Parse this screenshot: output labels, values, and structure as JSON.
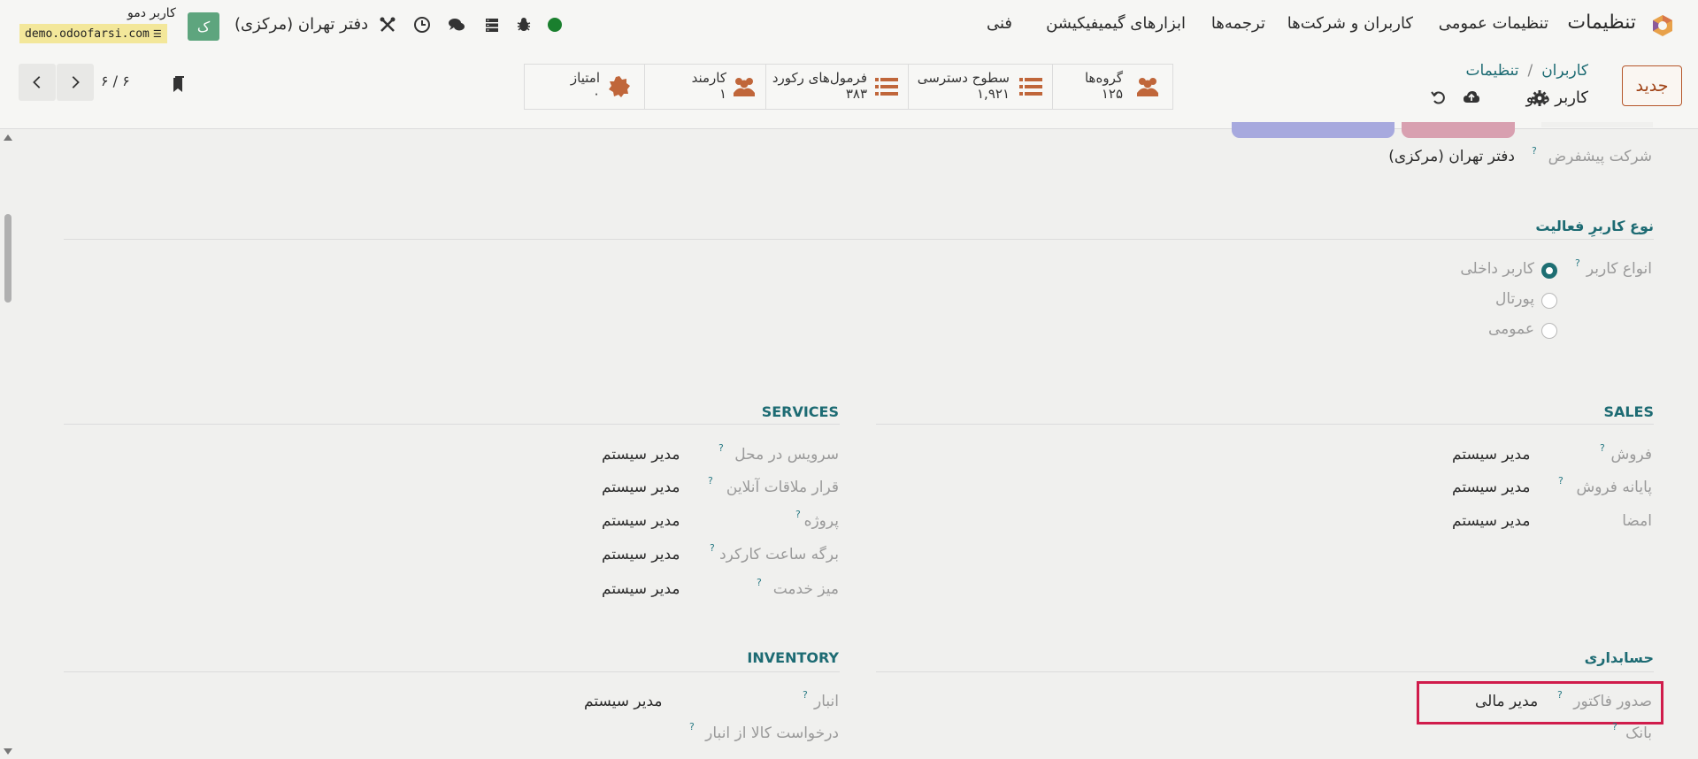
{
  "topbar": {
    "app_title": "تنظیمات",
    "menu": [
      "تنظیمات عمومی",
      "کاربران و شرکت‌ها",
      "ترجمه‌ها",
      "ابزارهای گیمیفیکیشن",
      "فنی"
    ],
    "company": "دفتر تهران (مرکزی)",
    "user_name": "کاربر دمو",
    "db_name": "demo.odoofarsi.com",
    "avatar_letter": "ک",
    "status_color": "#1a7f2e"
  },
  "control": {
    "new_button": "جدید",
    "breadcrumb_parent": "تنظیمات",
    "breadcrumb_sep": "/",
    "breadcrumb_current": "کاربران",
    "record_name": "کاربر دمو",
    "pager": "۶ / ۶",
    "stats": [
      {
        "label": "گروه‌ها",
        "value": "۱۲۵",
        "icon": "users-icon"
      },
      {
        "label": "سطوح دسترسی",
        "value": "۱,۹۲۱",
        "icon": "list-icon"
      },
      {
        "label": "فرمول‌های رکورد",
        "value": "۳۸۳",
        "icon": "list-icon"
      },
      {
        "label": "کارمند",
        "value": "۱",
        "icon": "users-icon"
      },
      {
        "label": "امتیاز",
        "value": "۰",
        "icon": "badge-icon"
      }
    ]
  },
  "form": {
    "default_company_label": "شرکت پیشفرض",
    "default_company_value": "دفتر تهران (مرکزی)",
    "user_type_section": "نوع کاربرِ فعالیت",
    "user_type_label": "انواع کاربر",
    "user_types": [
      "کاربر داخلی",
      "پورتال",
      "عمومی"
    ],
    "sales_title": "SALES",
    "services_title": "SERVICES",
    "accounting_title": "حسابداری",
    "inventory_title": "INVENTORY",
    "sales": [
      {
        "label": "فروش",
        "value": "مدیر سیستم"
      },
      {
        "label": "پایانه فروش",
        "value": "مدیر سیستم"
      },
      {
        "label": "امضا",
        "value": "مدیر سیستم"
      }
    ],
    "services": [
      {
        "label": "سرویس در محل",
        "value": "مدیر سیستم"
      },
      {
        "label": "قرار ملاقات آنلاین",
        "value": "مدیر سیستم"
      },
      {
        "label": "پروژه",
        "value": "مدیر سیستم"
      },
      {
        "label": "برگه ساعت کارکرد",
        "value": "مدیر سیستم"
      },
      {
        "label": "میز خدمت",
        "value": "مدیر سیستم"
      }
    ],
    "accounting": [
      {
        "label": "صدور فاکتور",
        "value": "مدیر مالی"
      },
      {
        "label": "بانک",
        "value": ""
      }
    ],
    "inventory": [
      {
        "label": "انبار",
        "value": "مدیر سیستم"
      },
      {
        "label": "درخواست کالا از انبار",
        "value": ""
      }
    ],
    "help_mark": "?",
    "highlight_color": "#d01c4b",
    "accent_color": "#1d6b73"
  }
}
